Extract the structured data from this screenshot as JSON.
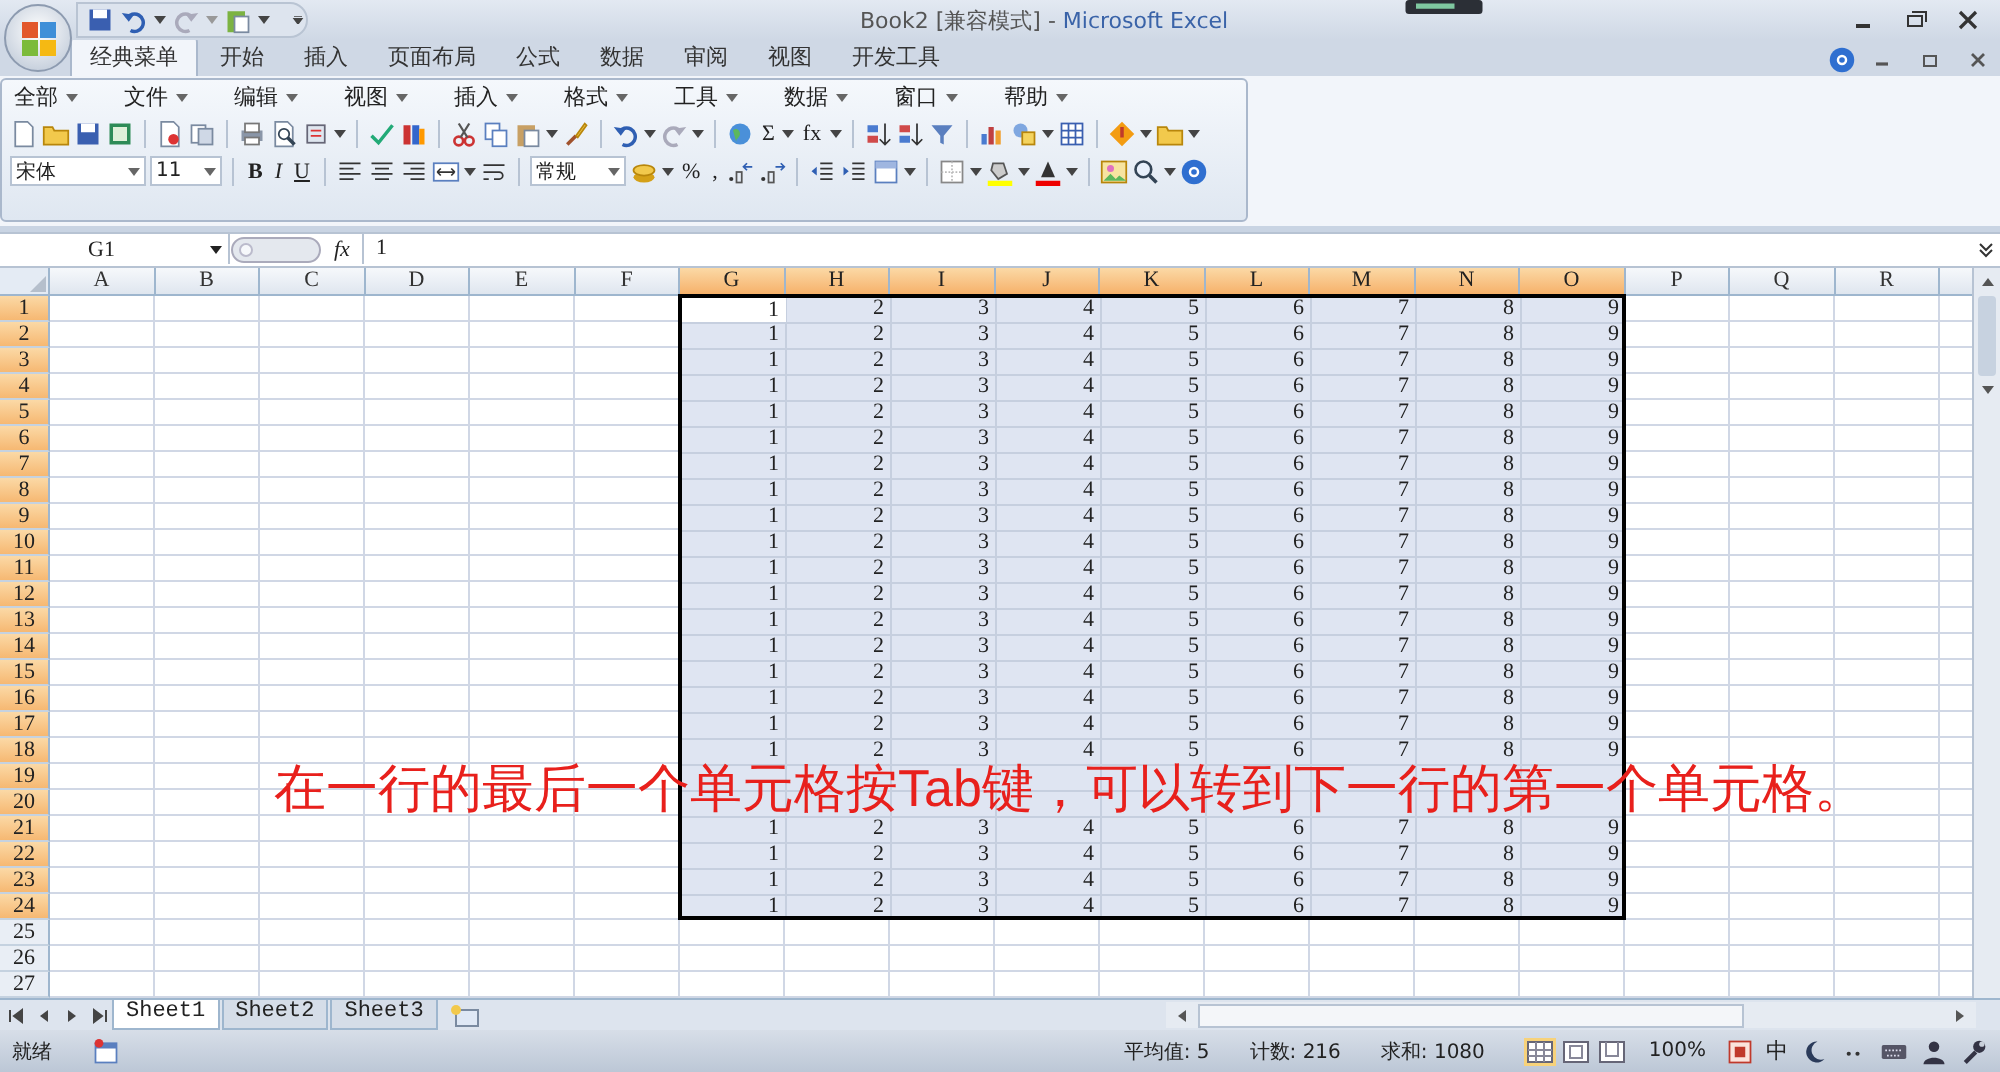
{
  "window": {
    "document_title": "Book2  [兼容模式] -",
    "app_title": "Microsoft Excel"
  },
  "ribbon_tabs": [
    {
      "label": "经典菜单",
      "selected": true
    },
    {
      "label": "开始",
      "selected": false
    },
    {
      "label": "插入",
      "selected": false
    },
    {
      "label": "页面布局",
      "selected": false
    },
    {
      "label": "公式",
      "selected": false
    },
    {
      "label": "数据",
      "selected": false
    },
    {
      "label": "审阅",
      "selected": false
    },
    {
      "label": "视图",
      "selected": false
    },
    {
      "label": "开发工具",
      "selected": false
    }
  ],
  "menu_bar": [
    "全部",
    "文件",
    "编辑",
    "视图",
    "插入",
    "格式",
    "工具",
    "数据",
    "窗口",
    "帮助"
  ],
  "toolbar": {
    "autosum_button": "Σ",
    "function_button": "fx",
    "font_box": "宋体",
    "size_box": "11",
    "style_buttons": [
      "B",
      "I",
      "U"
    ],
    "number_format_box": "常规",
    "percent_button": "%",
    "comma_button": ","
  },
  "formula_bar": {
    "name_box": "G1",
    "fx_label": "fx",
    "formula": "1"
  },
  "grid": {
    "columns": [
      {
        "label": "A",
        "selected": false
      },
      {
        "label": "B",
        "selected": false
      },
      {
        "label": "C",
        "selected": false
      },
      {
        "label": "D",
        "selected": false
      },
      {
        "label": "E",
        "selected": false
      },
      {
        "label": "F",
        "selected": false
      },
      {
        "label": "G",
        "selected": true
      },
      {
        "label": "H",
        "selected": true
      },
      {
        "label": "I",
        "selected": true
      },
      {
        "label": "J",
        "selected": true
      },
      {
        "label": "K",
        "selected": true
      },
      {
        "label": "L",
        "selected": true
      },
      {
        "label": "M",
        "selected": true
      },
      {
        "label": "N",
        "selected": true
      },
      {
        "label": "O",
        "selected": true
      },
      {
        "label": "P",
        "selected": false
      },
      {
        "label": "Q",
        "selected": false
      },
      {
        "label": "R",
        "selected": false
      }
    ],
    "rows": [
      {
        "label": "1",
        "selected": true,
        "values": [
          "1",
          "2",
          "3",
          "4",
          "5",
          "6",
          "7",
          "8",
          "9"
        ]
      },
      {
        "label": "2",
        "selected": true,
        "values": [
          "1",
          "2",
          "3",
          "4",
          "5",
          "6",
          "7",
          "8",
          "9"
        ]
      },
      {
        "label": "3",
        "selected": true,
        "values": [
          "1",
          "2",
          "3",
          "4",
          "5",
          "6",
          "7",
          "8",
          "9"
        ]
      },
      {
        "label": "4",
        "selected": true,
        "values": [
          "1",
          "2",
          "3",
          "4",
          "5",
          "6",
          "7",
          "8",
          "9"
        ]
      },
      {
        "label": "5",
        "selected": true,
        "values": [
          "1",
          "2",
          "3",
          "4",
          "5",
          "6",
          "7",
          "8",
          "9"
        ]
      },
      {
        "label": "6",
        "selected": true,
        "values": [
          "1",
          "2",
          "3",
          "4",
          "5",
          "6",
          "7",
          "8",
          "9"
        ]
      },
      {
        "label": "7",
        "selected": true,
        "values": [
          "1",
          "2",
          "3",
          "4",
          "5",
          "6",
          "7",
          "8",
          "9"
        ]
      },
      {
        "label": "8",
        "selected": true,
        "values": [
          "1",
          "2",
          "3",
          "4",
          "5",
          "6",
          "7",
          "8",
          "9"
        ]
      },
      {
        "label": "9",
        "selected": true,
        "values": [
          "1",
          "2",
          "3",
          "4",
          "5",
          "6",
          "7",
          "8",
          "9"
        ]
      },
      {
        "label": "10",
        "selected": true,
        "values": [
          "1",
          "2",
          "3",
          "4",
          "5",
          "6",
          "7",
          "8",
          "9"
        ]
      },
      {
        "label": "11",
        "selected": true,
        "values": [
          "1",
          "2",
          "3",
          "4",
          "5",
          "6",
          "7",
          "8",
          "9"
        ]
      },
      {
        "label": "12",
        "selected": true,
        "values": [
          "1",
          "2",
          "3",
          "4",
          "5",
          "6",
          "7",
          "8",
          "9"
        ]
      },
      {
        "label": "13",
        "selected": true,
        "values": [
          "1",
          "2",
          "3",
          "4",
          "5",
          "6",
          "7",
          "8",
          "9"
        ]
      },
      {
        "label": "14",
        "selected": true,
        "values": [
          "1",
          "2",
          "3",
          "4",
          "5",
          "6",
          "7",
          "8",
          "9"
        ]
      },
      {
        "label": "15",
        "selected": true,
        "values": [
          "1",
          "2",
          "3",
          "4",
          "5",
          "6",
          "7",
          "8",
          "9"
        ]
      },
      {
        "label": "16",
        "selected": true,
        "values": [
          "1",
          "2",
          "3",
          "4",
          "5",
          "6",
          "7",
          "8",
          "9"
        ]
      },
      {
        "label": "17",
        "selected": true,
        "values": [
          "1",
          "2",
          "3",
          "4",
          "5",
          "6",
          "7",
          "8",
          "9"
        ]
      },
      {
        "label": "18",
        "selected": true,
        "values": [
          "1",
          "2",
          "3",
          "4",
          "5",
          "6",
          "7",
          "8",
          "9"
        ]
      },
      {
        "label": "19",
        "selected": true
      },
      {
        "label": "20",
        "selected": true
      },
      {
        "label": "21",
        "selected": true,
        "values": [
          "1",
          "2",
          "3",
          "4",
          "5",
          "6",
          "7",
          "8",
          "9"
        ]
      },
      {
        "label": "22",
        "selected": true,
        "values": [
          "1",
          "2",
          "3",
          "4",
          "5",
          "6",
          "7",
          "8",
          "9"
        ]
      },
      {
        "label": "23",
        "selected": true,
        "values": [
          "1",
          "2",
          "3",
          "4",
          "5",
          "6",
          "7",
          "8",
          "9"
        ]
      },
      {
        "label": "24",
        "selected": true,
        "values": [
          "1",
          "2",
          "3",
          "4",
          "5",
          "6",
          "7",
          "8",
          "9"
        ]
      },
      {
        "label": "25",
        "selected": false
      },
      {
        "label": "26",
        "selected": false
      },
      {
        "label": "27",
        "selected": false
      }
    ]
  },
  "sheet_tabs": [
    {
      "label": "Sheet1",
      "selected": true
    },
    {
      "label": "Sheet2",
      "selected": false
    },
    {
      "label": "Sheet3",
      "selected": false
    }
  ],
  "status_bar": {
    "status": "就绪",
    "average": "平均值: 5",
    "count": "计数: 216",
    "sum": "求和: 1080",
    "view_buttons": [
      {
        "kind": "normal",
        "selected": true
      },
      {
        "kind": "page_layout",
        "selected": false
      },
      {
        "kind": "page_break",
        "selected": false
      }
    ],
    "zoom": "100%",
    "ime_label": "中"
  },
  "caption": "在一行的最后一个单元格按Tab键，可以转到下一行的第一个单元格。"
}
